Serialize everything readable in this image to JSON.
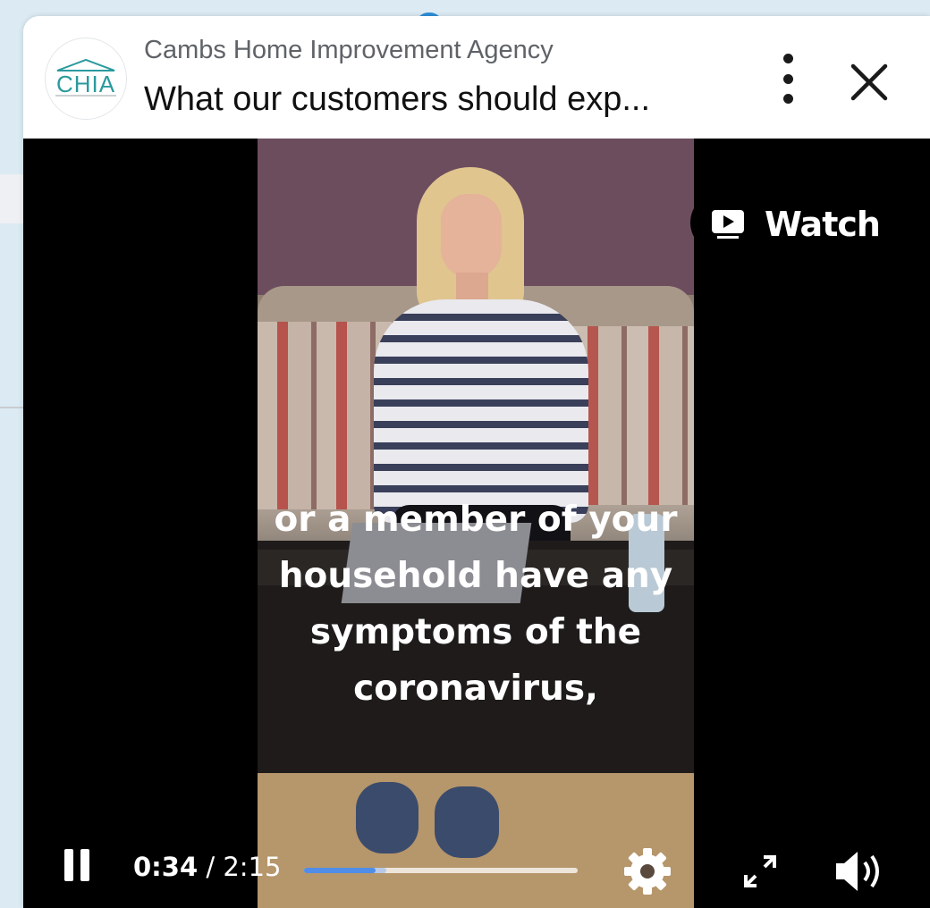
{
  "header": {
    "channel_name": "Cambs Home Improvement Agency",
    "video_title": "What our customers should exp...",
    "logo_text": "CHIA"
  },
  "player": {
    "watch_label": "Watch",
    "current_time": "0:34",
    "separator": " / ",
    "duration": "2:15",
    "progress_fraction": 0.26,
    "buffered_fraction": 0.3,
    "caption_lines": [
      "or a member of your",
      "household have any",
      "symptoms of the",
      "coronavirus,"
    ]
  },
  "colors": {
    "accent": "#4f8de8",
    "logo_teal": "#2a9a9e",
    "background": "#dbeaf3"
  },
  "icons": [
    "more-vertical-icon",
    "close-icon",
    "play-box-icon",
    "pause-icon",
    "gear-icon",
    "expand-icon",
    "volume-icon"
  ]
}
